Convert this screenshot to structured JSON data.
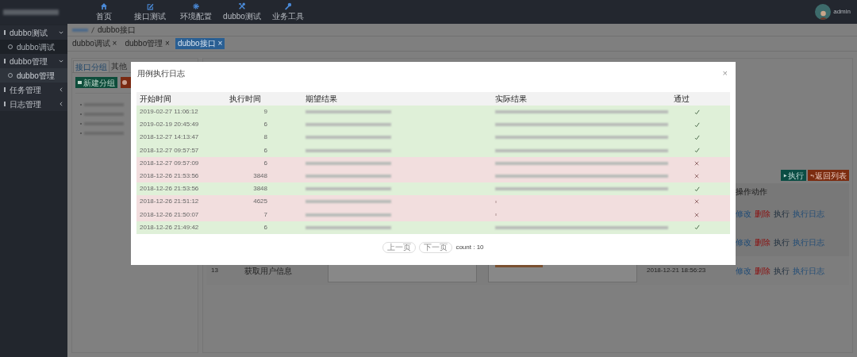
{
  "top_nav": {
    "items": [
      {
        "label": "首页"
      },
      {
        "label": "接口测试"
      },
      {
        "label": "环境配置"
      },
      {
        "label": "dubbo测试"
      },
      {
        "label": "业务工具"
      }
    ],
    "user": "admin"
  },
  "sidebar": {
    "items": [
      {
        "label": "dubbo测试",
        "expanded": true,
        "children": [
          {
            "label": "dubbo调试",
            "selected": false
          }
        ]
      },
      {
        "label": "dubbo管理",
        "expanded": true,
        "children": [
          {
            "label": "dubbo管理",
            "selected": true
          }
        ]
      },
      {
        "label": "任务管理",
        "expanded": false
      },
      {
        "label": "日志管理",
        "expanded": false
      }
    ]
  },
  "breadcrumb": [
    "dubbo接口"
  ],
  "page_tabs": [
    {
      "label": "dubbo调试 ×",
      "selected": false
    },
    {
      "label": "dubbo管理 ×",
      "selected": false
    },
    {
      "label": "dubbo接口 ×",
      "selected": true
    }
  ],
  "left_panel": {
    "tabs": [
      {
        "label": "接口分组",
        "selected": true
      },
      {
        "label": "其他",
        "selected": false
      }
    ],
    "new_button": "新建分组"
  },
  "right_panel": {
    "buttons": [
      {
        "label": "执行",
        "kind": "run"
      },
      {
        "label": "返回列表",
        "kind": "back"
      }
    ],
    "action_header": "操作动作",
    "rows": [
      {
        "actions": [
          "修改",
          "删除",
          "执行",
          "执行日志"
        ]
      },
      {
        "actions": [
          "修改",
          "删除",
          "执行",
          "执行日志"
        ]
      },
      {
        "number": "13",
        "name": "获取用户信息",
        "date": "2018-12-21 18:56:23",
        "actions": [
          "修改",
          "删除",
          "执行",
          "执行日志"
        ]
      }
    ]
  },
  "modal": {
    "title": "用例执行日志",
    "close": "×",
    "columns": [
      "开始时间",
      "执行时间",
      "期望结果",
      "实际结果",
      "通过"
    ],
    "rows": [
      {
        "start": "2019-02-27 11:06:12",
        "duration": "9",
        "actual_shown": true,
        "passed": true
      },
      {
        "start": "2019-02-19 20:45:49",
        "duration": "6",
        "actual_shown": true,
        "passed": true
      },
      {
        "start": "2018-12-27 14:13:47",
        "duration": "8",
        "actual_shown": true,
        "passed": true
      },
      {
        "start": "2018-12-27 09:57:57",
        "duration": "6",
        "actual_shown": true,
        "passed": true
      },
      {
        "start": "2018-12-27 09:57:09",
        "duration": "6",
        "actual_shown": true,
        "passed": false
      },
      {
        "start": "2018-12-26 21:53:56",
        "duration": "3848",
        "actual_shown": true,
        "passed": false
      },
      {
        "start": "2018-12-26 21:53:56",
        "duration": "3848",
        "actual_shown": true,
        "passed": true
      },
      {
        "start": "2018-12-26 21:51:12",
        "duration": "4625",
        "actual_shown": false,
        "passed": false
      },
      {
        "start": "2018-12-26 21:50:07",
        "duration": "7",
        "actual_shown": false,
        "passed": false
      },
      {
        "start": "2018-12-26 21:49:42",
        "duration": "6",
        "actual_shown": true,
        "passed": true
      }
    ],
    "pager": {
      "prev": "上一页",
      "next": "下一页",
      "count": "count : 10"
    }
  }
}
